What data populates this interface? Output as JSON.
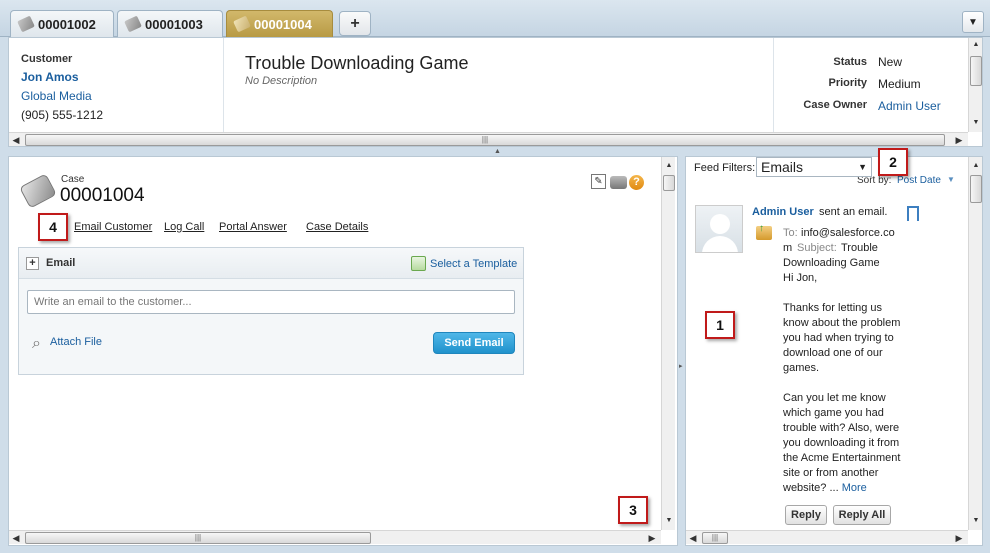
{
  "tabs": [
    {
      "label": "00001002",
      "active": false
    },
    {
      "label": "00001003",
      "active": false
    },
    {
      "label": "00001004",
      "active": true
    }
  ],
  "new_tab_label": "+",
  "header": {
    "customer_label": "Customer",
    "customer_name": "Jon Amos",
    "company": "Global Media",
    "phone": "(905) 555-1212",
    "case_title": "Trouble Downloading Game",
    "case_description": "No Description",
    "status_label": "Status",
    "status_value": "New",
    "priority_label": "Priority",
    "priority_value": "Medium",
    "owner_label": "Case Owner",
    "owner_value": "Admin User"
  },
  "case": {
    "type_label": "Case",
    "number": "00001004",
    "actions": [
      "Email Customer",
      "Log Call",
      "Portal Answer",
      "Case Details"
    ]
  },
  "email_publisher": {
    "title": "Email",
    "template_link": "Select a Template",
    "placeholder": "Write an email to the customer...",
    "attach_label": "Attach File",
    "send_label": "Send Email"
  },
  "feed": {
    "filters_label": "Feed Filters:",
    "filter_value": "Emails",
    "sort_label": "Sort by:",
    "sort_value": "Post Date",
    "author": "Admin User",
    "action_text": "sent an email.",
    "to_label": "To:",
    "to_value_line1": "info@salesforce.co",
    "to_value_line2": "m",
    "subject_label": "Subject:",
    "subject_line1": "Trouble",
    "subject_line2": "Downloading Game",
    "body_lines": [
      "Hi Jon,",
      "",
      "Thanks for letting us",
      "know about the problem",
      "you had when trying to",
      "download one of our",
      "games.",
      "",
      "Can you let me know",
      "which game you had",
      "trouble with? Also, were",
      "you downloading it from",
      "the Acme Entertainment",
      "site or from another",
      "website? ..."
    ],
    "more_label": "More",
    "reply_label": "Reply",
    "reply_all_label": "Reply All"
  },
  "callouts": [
    "1",
    "2",
    "3",
    "4"
  ],
  "colors": {
    "active_tab": "#c2a54f",
    "link": "#1a5e9e",
    "send_button": "#2b9ad6",
    "callout_border": "#c01a1a"
  }
}
